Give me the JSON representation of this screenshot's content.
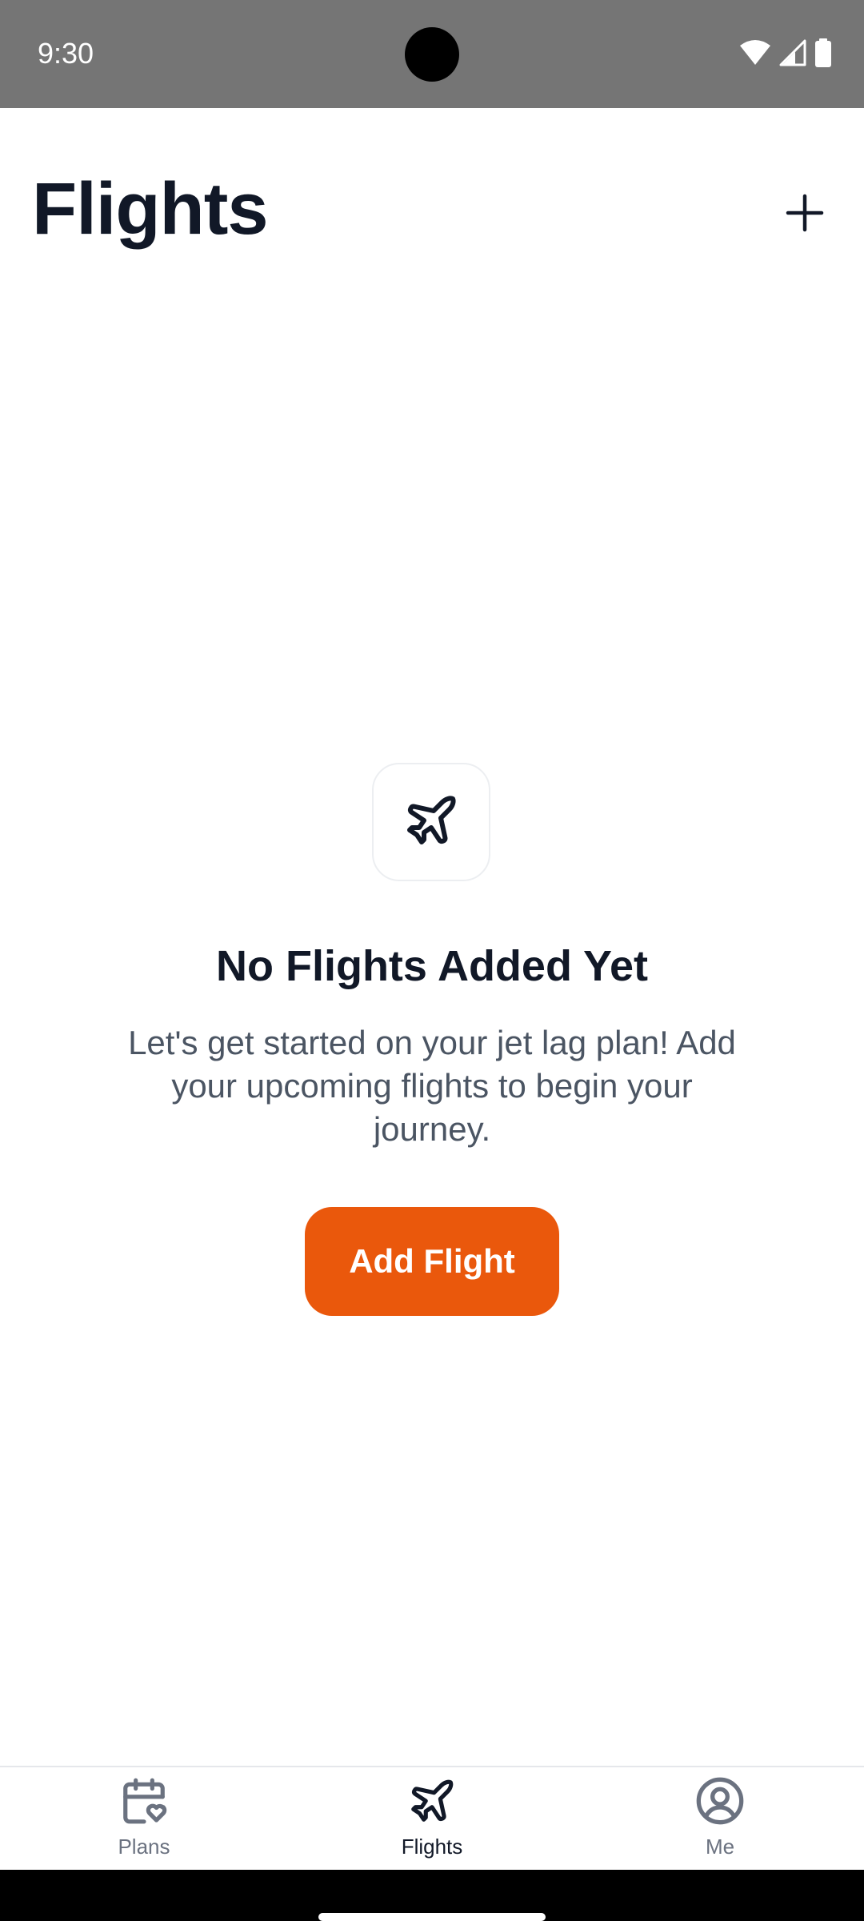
{
  "status_bar": {
    "time": "9:30",
    "icons": [
      "wifi-icon",
      "cellular-icon",
      "battery-icon"
    ]
  },
  "header": {
    "title": "Flights",
    "add_icon": "plus-icon"
  },
  "empty_state": {
    "icon": "airplane-icon",
    "title": "No Flights Added Yet",
    "description": "Let's get started on your jet lag plan! Add your upcoming flights to begin your journey.",
    "button_label": "Add Flight"
  },
  "bottom_nav": {
    "items": [
      {
        "label": "Plans",
        "icon": "calendar-heart-icon",
        "active": false
      },
      {
        "label": "Flights",
        "icon": "airplane-icon",
        "active": true
      },
      {
        "label": "Me",
        "icon": "user-circle-icon",
        "active": false
      }
    ]
  },
  "colors": {
    "status_bar_bg": "#757575",
    "title_text": "#111827",
    "body_text": "#4b5563",
    "accent": "#ea580c",
    "nav_inactive": "#6b7280"
  }
}
